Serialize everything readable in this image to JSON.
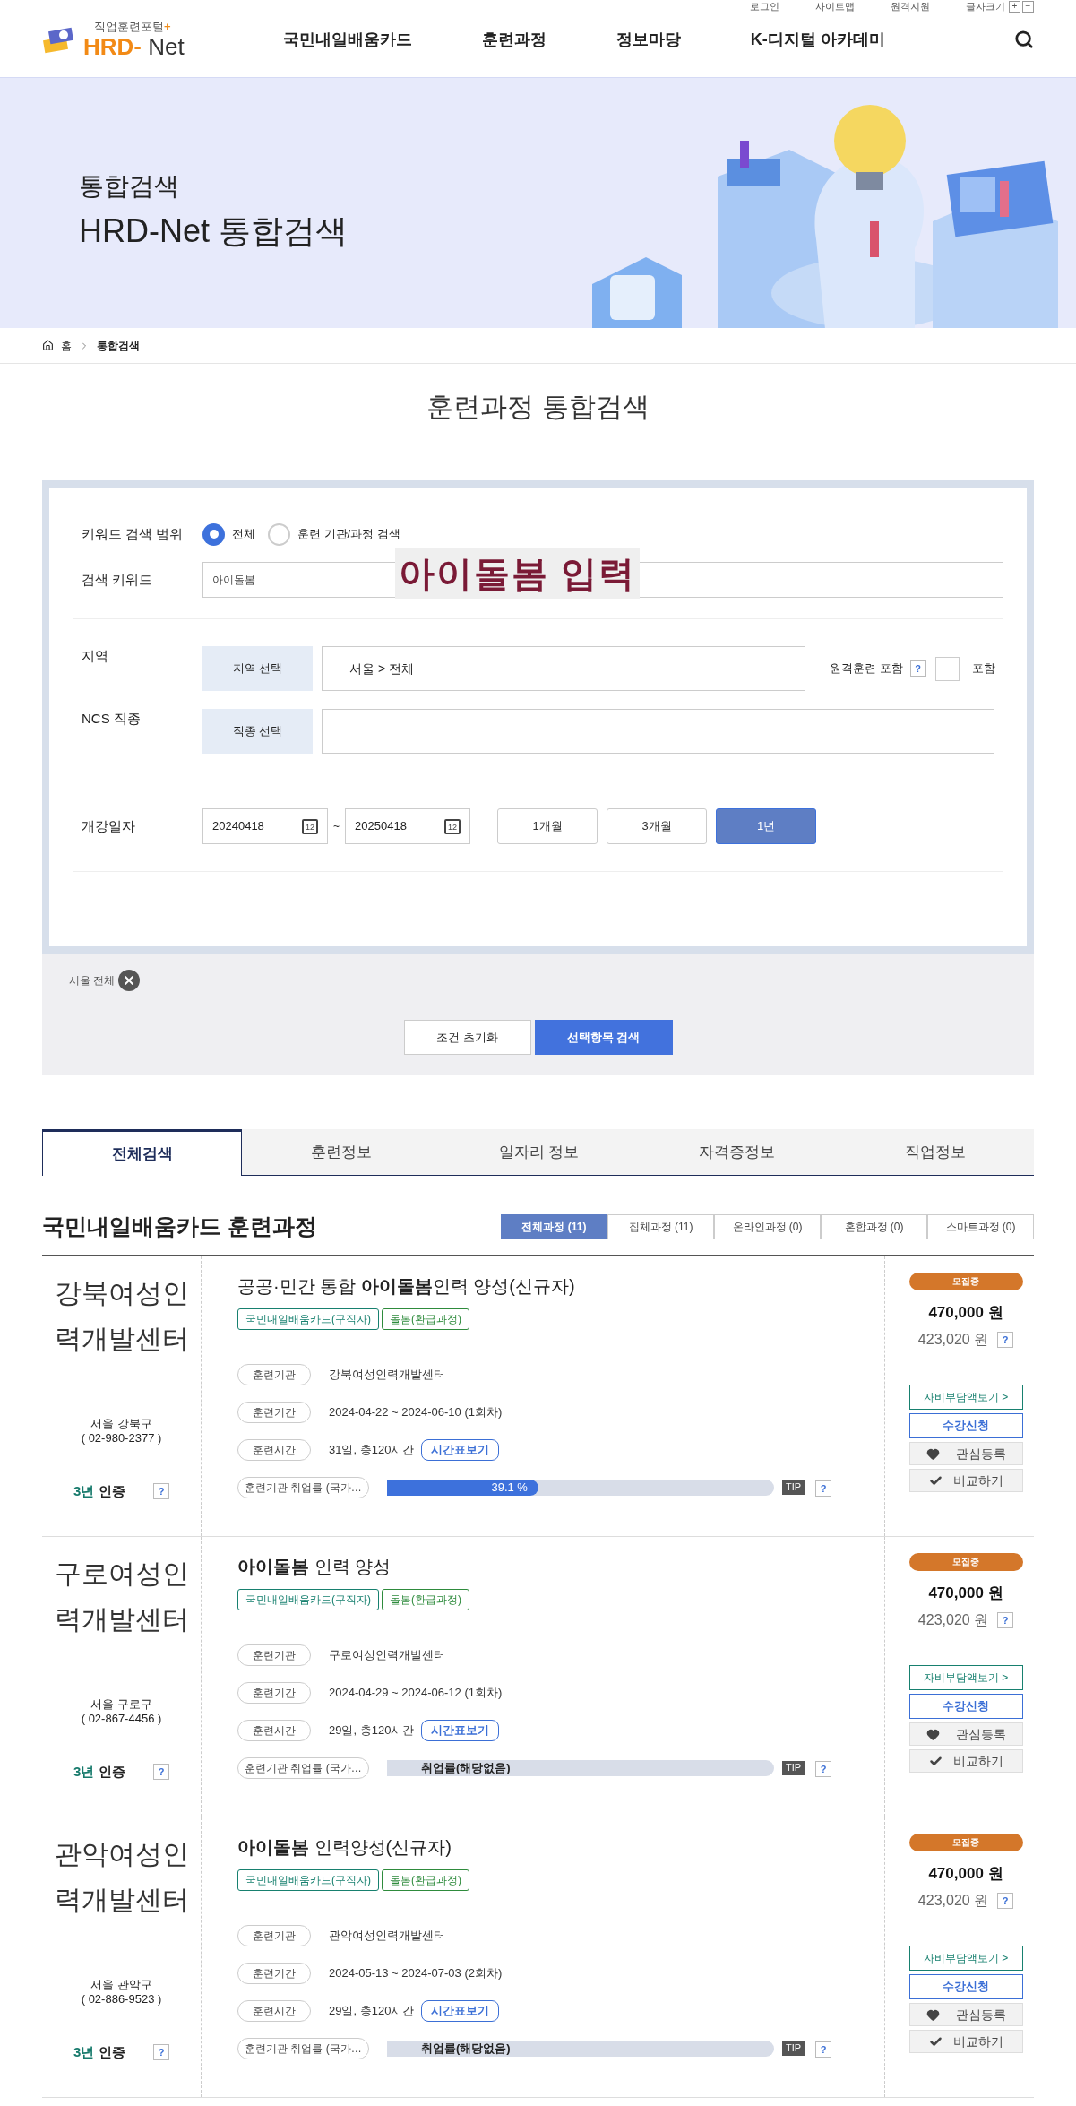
{
  "utility_links": [
    "로그인",
    "사이트맵",
    "원격지원",
    "글자크기"
  ],
  "font_size_buttons": [
    "+",
    "−"
  ],
  "logo": {
    "tagline": "직업훈련포털",
    "plus": "+",
    "name_bold": "HRD",
    "dash": "-",
    "name_rest": "Net"
  },
  "nav": [
    "국민내일배움카드",
    "훈련과정",
    "정보마당",
    "K-디지털 아카데미"
  ],
  "banner": {
    "title": "통합검색",
    "subtitle": "HRD-Net 통합검색"
  },
  "breadcrumb": [
    "홈",
    "통합검색"
  ],
  "page_title": "훈련과정 통합검색",
  "search_form": {
    "scope": {
      "label": "키워드 검색 범위",
      "options": [
        {
          "label": "전체",
          "selected": true
        },
        {
          "label": "훈련 기관/과정 검색",
          "selected": false
        }
      ]
    },
    "keyword": {
      "label": "검색 키워드",
      "value": "아이돌봄"
    },
    "annotation": "아이돌봄 입력",
    "region": {
      "label": "지역",
      "button": "지역 선택",
      "value": "서울 > 전체",
      "remote_label": "원격훈련 포함",
      "help": "?",
      "include_label": "포함",
      "include_checked": false
    },
    "ncs": {
      "label": "NCS 직종",
      "button": "직종 선택"
    },
    "date": {
      "label": "개강일자",
      "from": "20240418",
      "from_calendar_day": "12",
      "separator": "~",
      "to": "20250418",
      "to_calendar_day": "12",
      "periods": [
        {
          "label": "1개월",
          "selected": false
        },
        {
          "label": "3개월",
          "selected": false
        },
        {
          "label": "1년",
          "selected": true
        }
      ]
    }
  },
  "selected_conditions": [
    {
      "label": "서울 전체"
    }
  ],
  "form_buttons": {
    "reset": "조건 초기화",
    "search": "선택항목 검색"
  },
  "tabs": [
    {
      "label": "전체검색",
      "selected": true
    },
    {
      "label": "훈련정보",
      "selected": false
    },
    {
      "label": "일자리 정보",
      "selected": false
    },
    {
      "label": "자격증정보",
      "selected": false
    },
    {
      "label": "직업정보",
      "selected": false
    }
  ],
  "section_title": "국민내일배움카드 훈련과정",
  "filters": [
    {
      "label": "전체과정 (11)",
      "selected": true
    },
    {
      "label": "집체과정 (11)",
      "selected": false
    },
    {
      "label": "온라인과정 (0)",
      "selected": false
    },
    {
      "label": "혼합과정 (0)",
      "selected": false
    },
    {
      "label": "스마트과정 (0)",
      "selected": false
    }
  ],
  "courses": [
    {
      "institution": "강북여성인력개발센터",
      "location": "서울 강북구",
      "phone": "( 02-980-2377 )",
      "cert": "3년",
      "cert_suffix": "인증",
      "title": "공공·민간 통합 **아이돌봄**인력 양성(신규자)",
      "tags": [
        "국민내일배움카드(구직자)",
        "돌봄(환급과정)"
      ],
      "info": [
        {
          "label": "훈련기관",
          "value": "강북여성인력개발센터"
        },
        {
          "label": "훈련기간",
          "value": "2024-04-22 ~ 2024-06-10 (1회차)"
        },
        {
          "label": "훈련시간",
          "value": "31일, 총120시간",
          "link": "시간표보기"
        }
      ],
      "rate_label": "훈련기관 취업률 (국가…",
      "rate": {
        "kind": "rate",
        "level": 0.391,
        "text": "39.1 %"
      },
      "tip": "TIP",
      "status": "모집중",
      "price": "470,000 원",
      "self_pay": "423,020 원",
      "buttons": {
        "self_pay_view": "자비부담액보기 >",
        "apply": "수강신청",
        "wish": "관심등록",
        "compare": "비교하기"
      }
    },
    {
      "institution": "구로여성인력개발센터",
      "location": "서울 구로구",
      "phone": "( 02-867-4456 )",
      "cert": "3년",
      "cert_suffix": "인증",
      "title": "**아이돌봄** 인력 양성",
      "tags": [
        "국민내일배움카드(구직자)",
        "돌봄(환급과정)"
      ],
      "info": [
        {
          "label": "훈련기관",
          "value": "구로여성인력개발센터"
        },
        {
          "label": "훈련기간",
          "value": "2024-04-29 ~ 2024-06-12 (1회차)"
        },
        {
          "label": "훈련시간",
          "value": "29일, 총120시간",
          "link": "시간표보기"
        }
      ],
      "rate_label": "훈련기관 취업률 (국가…",
      "rate": {
        "kind": "none",
        "text": "취업률(해당없음)"
      },
      "tip": "TIP",
      "status": "모집중",
      "price": "470,000 원",
      "self_pay": "423,020 원",
      "buttons": {
        "self_pay_view": "자비부담액보기 >",
        "apply": "수강신청",
        "wish": "관심등록",
        "compare": "비교하기"
      }
    },
    {
      "institution": "관악여성인력개발센터",
      "location": "서울 관악구",
      "phone": "( 02-886-9523 )",
      "cert": "3년",
      "cert_suffix": "인증",
      "title": "**아이돌봄** 인력양성(신규자)",
      "tags": [
        "국민내일배움카드(구직자)",
        "돌봄(환급과정)"
      ],
      "info": [
        {
          "label": "훈련기관",
          "value": "관악여성인력개발센터"
        },
        {
          "label": "훈련기간",
          "value": "2024-05-13 ~ 2024-07-03 (2회차)"
        },
        {
          "label": "훈련시간",
          "value": "29일, 총120시간",
          "link": "시간표보기"
        }
      ],
      "rate_label": "훈련기관 취업률 (국가…",
      "rate": {
        "kind": "none",
        "text": "취업률(해당없음)"
      },
      "tip": "TIP",
      "status": "모집중",
      "price": "470,000 원",
      "self_pay": "423,020 원",
      "buttons": {
        "self_pay_view": "자비부담액보기 >",
        "apply": "수강신청",
        "wish": "관심등록",
        "compare": "비교하기"
      }
    }
  ],
  "card_buttons": {
    "help": "?"
  }
}
